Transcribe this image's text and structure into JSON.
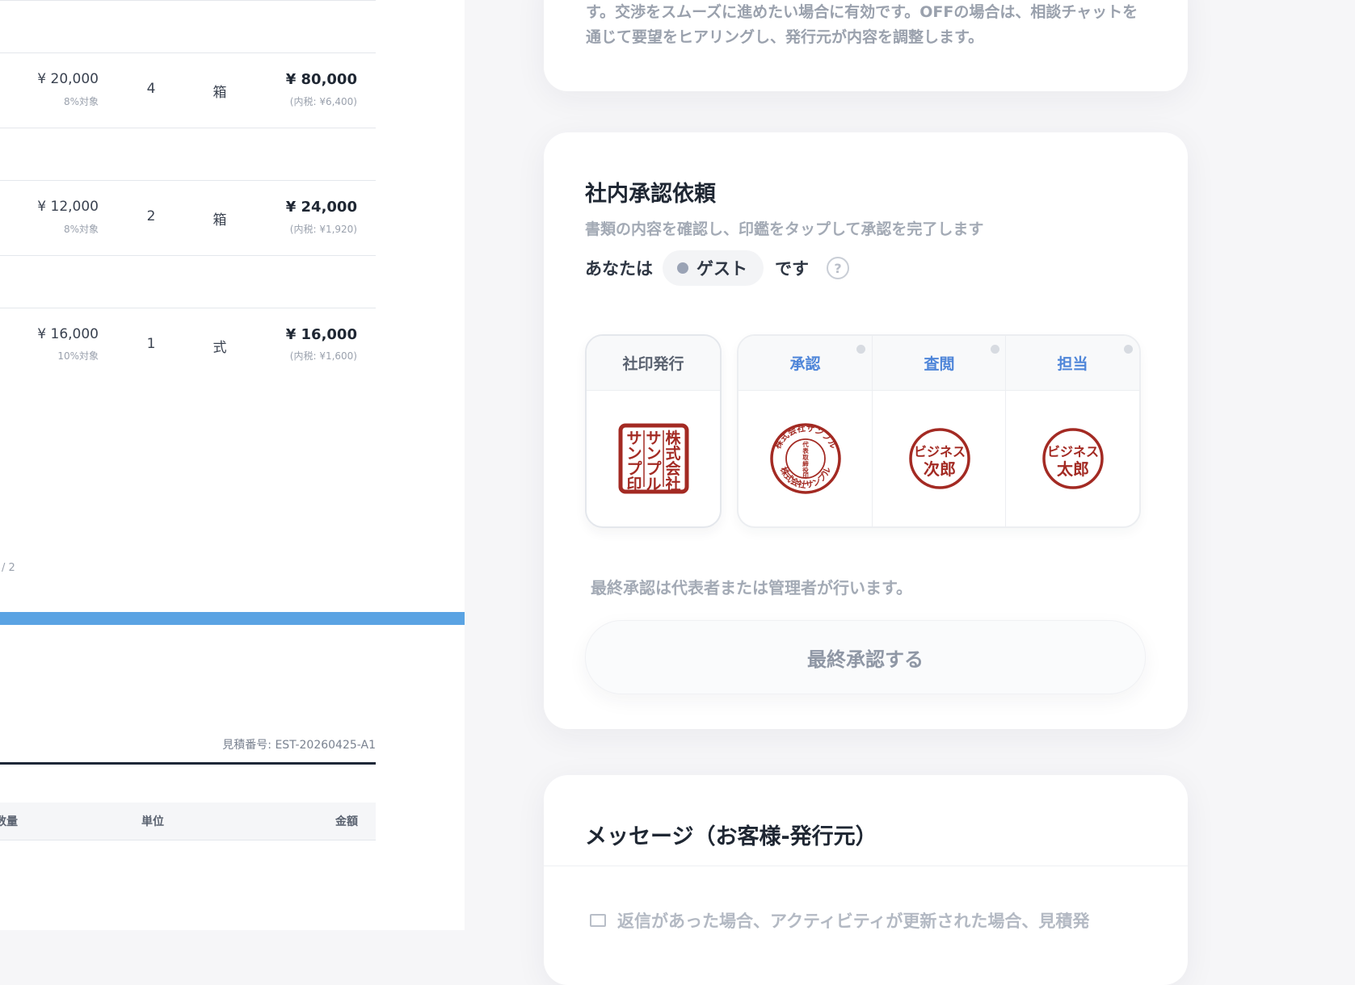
{
  "document": {
    "rows": [
      {
        "price": "¥ 20,000",
        "tax": "8%対象",
        "qty": "4",
        "unit": "箱",
        "amount": "¥ 80,000",
        "incl": "(内税: ¥6,400)"
      },
      {
        "price": "¥ 12,000",
        "tax": "8%対象",
        "qty": "2",
        "unit": "箱",
        "amount": "¥ 24,000",
        "incl": "(内税: ¥1,920)"
      },
      {
        "price": "¥ 16,000",
        "tax": "10%対象",
        "qty": "1",
        "unit": "式",
        "amount": "¥ 16,000",
        "incl": "(内税: ¥1,600)"
      }
    ],
    "page_indicator": "/ 2",
    "estimate_number": "見積番号: EST-20260425-A1",
    "headers": {
      "qty": "数量",
      "unit": "単位",
      "amount": "金額"
    }
  },
  "top_card": {
    "text": "す。交渉をスムーズに進めたい場合に有効です。OFFの場合は、相談チャットを通じて要望をヒアリングし、発行元が内容を調整します。"
  },
  "approval": {
    "title": "社内承認依頼",
    "subtitle": "書類の内容を確認し、印鑑をタップして承認を完了します",
    "you_prefix": "あなたは",
    "role": "ゲスト",
    "you_suffix": "です",
    "help_glyph": "?",
    "seal_header": "社印発行",
    "columns": [
      {
        "label": "承認"
      },
      {
        "label": "査閲"
      },
      {
        "label": "担当"
      }
    ],
    "stamps": {
      "company_seal_text": "株式会社サンプル サンプル印",
      "representative_ring_text": "株式会社サンプル",
      "representative_center_text": "代表取締役印",
      "reviewer_name_top": "ビジネス",
      "reviewer_name_bottom": "次郎",
      "staff_name_top": "ビジネス",
      "staff_name_bottom": "太郎"
    },
    "stamp_color": "#a32a23",
    "final_note": "最終承認は代表者または管理者が行います。",
    "final_button": "最終承認する"
  },
  "message": {
    "title": "メッセージ（お客様-発行元）",
    "notice": "返信があった場合、アクティビティが更新された場合、見積発"
  },
  "colors": {
    "accent_blue": "#5aa3e3",
    "link_blue": "#4f86d9"
  }
}
